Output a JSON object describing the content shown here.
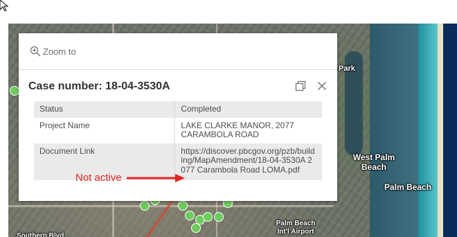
{
  "popup": {
    "zoom_label": "Zoom to",
    "title": "Case number: 18-04-3530A",
    "fields": [
      {
        "label": "Status",
        "value": "Completed"
      },
      {
        "label": "Project Name",
        "value": "LAKE CLARKE MANOR, 2077 CARAMBOLA ROAD"
      },
      {
        "label": "Document Link",
        "value": "https://discover.pbcgov.org/pzb/building/MapAmendment/18-04-3530A 2077 Carambola Road LOMA.pdf"
      }
    ]
  },
  "annotation": {
    "text": "Not active",
    "color": "#e02424"
  },
  "map": {
    "labels": [
      "West Palm Beach",
      "Palm Beach",
      "Palm Beach Int'l Airport",
      "Southern Blvd",
      "Park"
    ]
  },
  "icons": {
    "zoom": "magnifier-plus-icon",
    "dock": "dock-icon",
    "close": "close-icon",
    "cursor": "cursor-icon"
  },
  "colors": {
    "marker": "#6ccc5c",
    "title_text": "#323232",
    "row_stripe": "#eaeaea"
  }
}
